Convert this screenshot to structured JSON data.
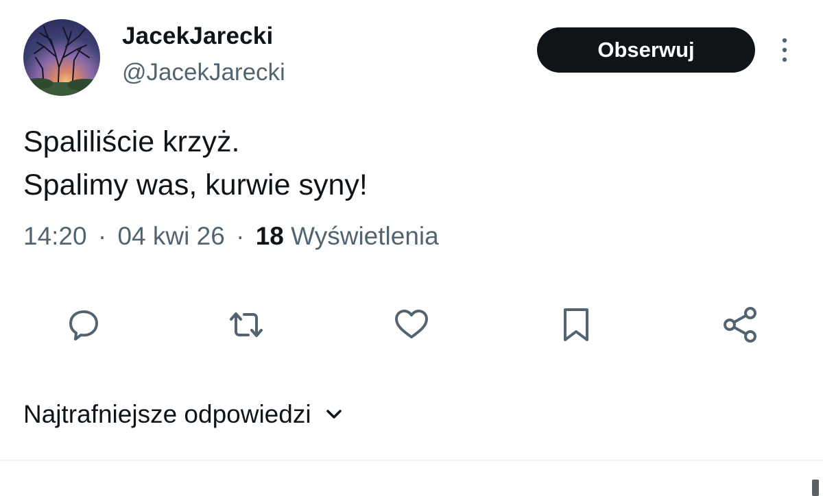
{
  "author": {
    "display_name": "JacekJarecki",
    "handle": "@JacekJarecki",
    "avatar_icon": "avatar-tree-sunset"
  },
  "header": {
    "follow_label": "Obserwuj",
    "more_icon": "more-vertical-icon"
  },
  "tweet": {
    "lines": [
      "Spaliliście krzyż.",
      "Spalimy was, kurwie syny!"
    ],
    "time": "14:20",
    "date": "04 kwi 26",
    "views_count": "18",
    "views_label": "Wyświetlenia",
    "separator": "·"
  },
  "actions": [
    {
      "icon": "reply-icon"
    },
    {
      "icon": "repost-icon"
    },
    {
      "icon": "like-icon"
    },
    {
      "icon": "bookmark-icon"
    },
    {
      "icon": "share-icon"
    }
  ],
  "replies": {
    "sort_label": "Najtrafniejsze odpowiedzi",
    "chevron_icon": "chevron-down-icon"
  },
  "colors": {
    "text_primary": "#0f1419",
    "text_secondary": "#536471",
    "icon": "#536471",
    "follow_bg": "#0f1419",
    "follow_text": "#ffffff",
    "divider": "#eff3f4"
  }
}
